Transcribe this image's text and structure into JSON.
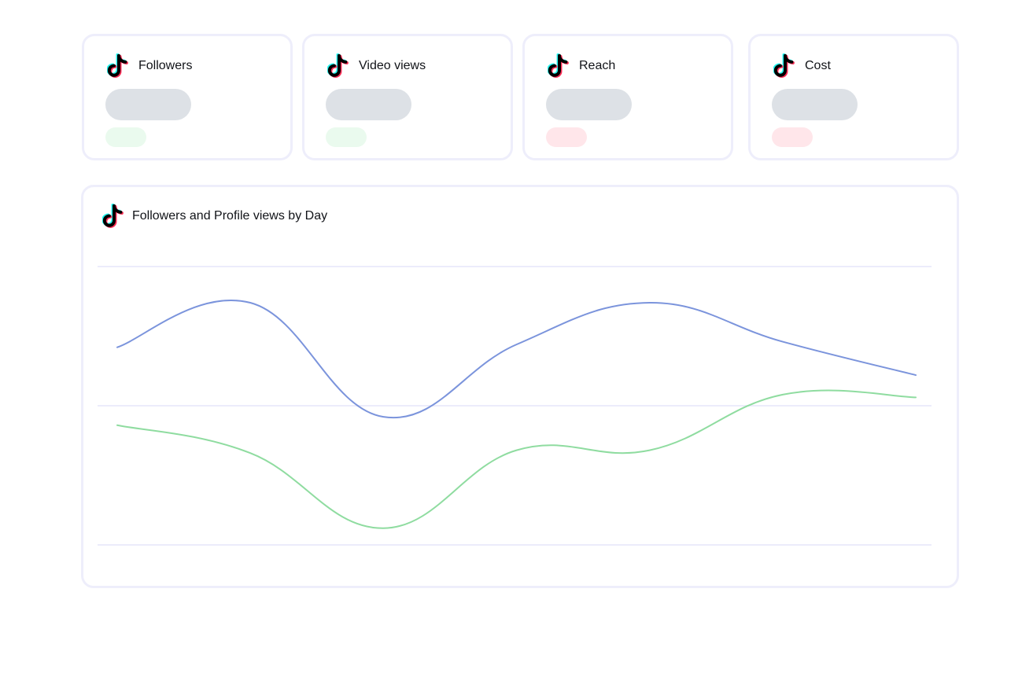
{
  "kpis": [
    {
      "title": "Followers",
      "delta_status": "positive",
      "delta_color": "#eafaee"
    },
    {
      "title": "Video views",
      "delta_status": "positive",
      "delta_color": "#eafaee"
    },
    {
      "title": "Reach",
      "delta_status": "negative",
      "delta_color": "#ffe6ea"
    },
    {
      "title": "Cost",
      "delta_status": "negative",
      "delta_color": "#ffe6ea"
    }
  ],
  "icons": {
    "platform": "tiktok-icon"
  },
  "colors": {
    "card_border": "#eeeefb",
    "skeleton": "#dde1e6",
    "gridline": "#ececfb",
    "series_followers": "#7b94dc",
    "series_profile_views": "#8fdca0"
  },
  "chart_data": {
    "type": "line",
    "title": "Followers and Profile views by Day",
    "x": [
      1,
      2,
      3,
      4,
      5,
      6,
      7
    ],
    "ylim": [
      0,
      100
    ],
    "gridlines": [
      0,
      50,
      100
    ],
    "grid": true,
    "series": [
      {
        "values": [
          71,
          87,
          46,
          72,
          87,
          73,
          61
        ],
        "color": "#7b94dc"
      },
      {
        "values": [
          43,
          33,
          6,
          34,
          34,
          54,
          53
        ],
        "color": "#8fdca0"
      }
    ]
  }
}
